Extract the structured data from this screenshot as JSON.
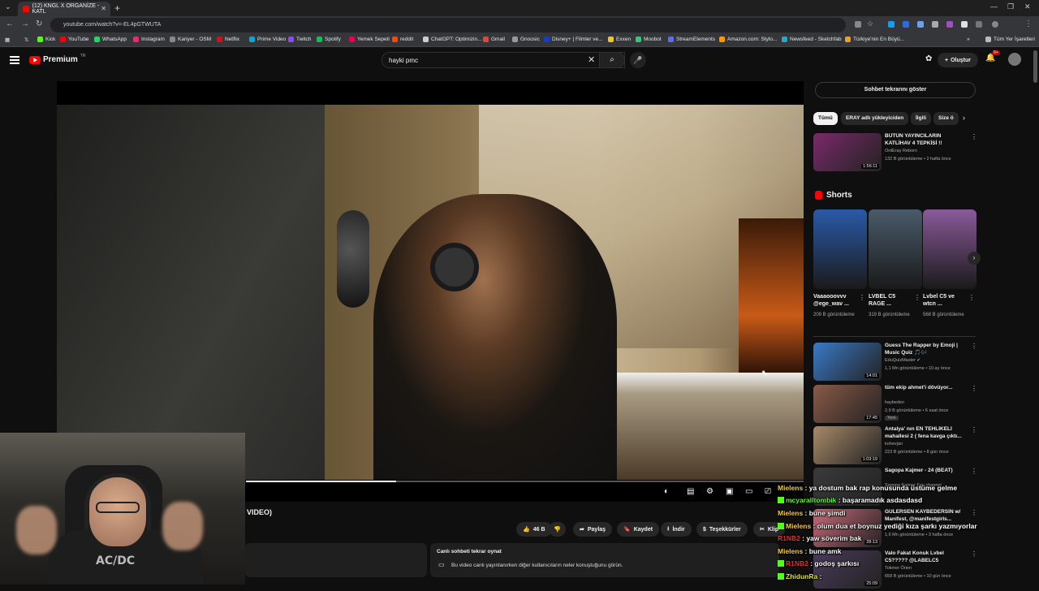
{
  "browser": {
    "tab_title": "(12) KNGL X ORGANİZE - KATL",
    "url": "youtube.com/watch?v=-EL4pGTWUTA",
    "bookmarks": [
      {
        "label": "Kick",
        "color": "#53fc18"
      },
      {
        "label": "YouTube",
        "color": "#ff0000"
      },
      {
        "label": "WhatsApp",
        "color": "#25d366"
      },
      {
        "label": "Instagram",
        "color": "#e1306c"
      },
      {
        "label": "Kariyer - OSM",
        "color": "#888888"
      },
      {
        "label": "Netflix",
        "color": "#e50914"
      },
      {
        "label": "Prime Video",
        "color": "#00a8e1"
      },
      {
        "label": "Twitch",
        "color": "#9146ff"
      },
      {
        "label": "Spotify",
        "color": "#1db954"
      },
      {
        "label": "Yemek Sepeti",
        "color": "#ea004b"
      },
      {
        "label": "reddit",
        "color": "#ff4500"
      },
      {
        "label": "ChatGPT: Optimizin...",
        "color": "#cccccc"
      },
      {
        "label": "Gmail",
        "color": "#ea4335"
      },
      {
        "label": "Gnoosic",
        "color": "#999999"
      },
      {
        "label": "Disney+ | Filmler ve...",
        "color": "#113ccf"
      },
      {
        "label": "Exxen",
        "color": "#f5c518"
      },
      {
        "label": "Moobot",
        "color": "#2ecc71"
      },
      {
        "label": "StreamElements",
        "color": "#5a6cff"
      },
      {
        "label": "Amazon.com: Stylo...",
        "color": "#ff9900"
      },
      {
        "label": "Newsfeed - Sketchfab",
        "color": "#1caad9"
      },
      {
        "label": "Türkiye'nin En Büyü...",
        "color": "#f0a020"
      }
    ],
    "all_bookmarks_label": "Tüm Yer İşaretleri"
  },
  "header": {
    "logo_text": "Premium",
    "logo_country": "TR",
    "search_value": "hayki pmc",
    "create_label": "Oluştur",
    "notif_count": "9+"
  },
  "player": {
    "progress": 0.27,
    "title_visible": "VIDEO)"
  },
  "actions": {
    "like_count": "46 B",
    "share": "Paylaş",
    "save": "Kaydet",
    "download": "İndir",
    "thanks": "Teşekkürler",
    "clip": "Klip"
  },
  "replay": {
    "title": "Canlı sohbeti tekrar oynat",
    "text": "Bu video canlı yayınlanırken diğer kullanıcıların neler konuştuğunu görün."
  },
  "webcam": {
    "shirt_text": "AC/DC"
  },
  "sidebar": {
    "chat_button": "Sohbet tekrarını göster",
    "chips": [
      "Tümü",
      "ERAY adlı yükleyiciden",
      "İlgili",
      "Size ö"
    ],
    "shorts_title": "Shorts",
    "videos": [
      {
        "title": "BÜTÜN YAYINCILARIN KATLİHAV 4 TEPKİSİ !!",
        "channel": "OrdEray Reborn",
        "meta": "132 B görüntüleme • 2 hafta önce",
        "duration": "1:56:11",
        "color": "#7a2a6a"
      },
      {
        "title": "Guess The Rapper by Emoji | Music Quiz 🎵🎶",
        "channel": "EduQuizMaster ✔",
        "meta": "1,1 Mn görüntüleme • 10 ay önce",
        "duration": "14:01",
        "color": "#3a7ac8"
      },
      {
        "title": "tüm ekip ahmet'i dövüyor...",
        "channel": "haybeden",
        "meta": "2,9 B görüntüleme • 6 saat önce",
        "badge": "Yeni",
        "duration": "17:45",
        "color": "#8a5a48"
      },
      {
        "title": "Antalya' nın EN TEHLİKELİ mahallesi 2 ( fena kavga çıktı...",
        "channel": "kohevjan",
        "meta": "223 B görüntüleme • 8 gün önce",
        "duration": "1:03:19",
        "color": "#a88a6a"
      },
      {
        "title": "Sagopa Kajmer - 24 (BEAT)",
        "channel": "Sagopa Kajmer Fan channel",
        "meta": "",
        "duration": "",
        "color": "#3a3a3a"
      },
      {
        "title": "GÜLERSEN KAYBEDERSİN w/ Manifest, @manifestgirls...",
        "channel": "",
        "meta": "1,6 Mn görüntüleme • 3 hafta önce",
        "duration": "28:13",
        "color": "#c86a7a"
      },
      {
        "title": "Valo Fakat Konuk Lvbel C5????? @LABELC5 @overdosevl",
        "channel": "Tokmer Önen",
        "meta": "658 B görüntüleme • 10 gün önce",
        "duration": "25:09",
        "color": "#4a3a5a"
      }
    ],
    "shorts": [
      {
        "title": "Vaaaooovvv @ege_wav ...",
        "views": "209 B görüntüleme",
        "color": "#2a5aa8"
      },
      {
        "title": "LVBEL C5 RAGE ...",
        "views": "319 B görüntüleme",
        "color": "#4a5a6a"
      },
      {
        "title": "Lvbel C5 ve wtcn ...",
        "views": "568 B görüntüleme",
        "color": "#8a5a9a"
      }
    ]
  },
  "chat": [
    {
      "user": "Mielens",
      "text": ": ya dostum bak rap konusunda üstüme gelme",
      "color": "#f5c542",
      "badge": ""
    },
    {
      "user": "mcyaralltombik",
      "text": ": başaramadık asdasdasd",
      "color": "#53fc18",
      "badge": "#53fc18"
    },
    {
      "user": "Mielens",
      "text": ": bune şimdi",
      "color": "#f5c542",
      "badge": ""
    },
    {
      "user": "Mielens",
      "text": ": olum dua et boynuz yediği kıza şarkı yazmıyorlar",
      "color": "#f5c542",
      "badge": "#53fc18"
    },
    {
      "user": "R1NB2",
      "text": ": yaw söverim bak",
      "color": "#e03030",
      "badge": ""
    },
    {
      "user": "Mielens",
      "text": ": bune amk",
      "color": "#f5c542",
      "badge": ""
    },
    {
      "user": "R1NB2",
      "text": ": godoş şarkısı",
      "color": "#e03030",
      "badge": "#53fc18"
    },
    {
      "user": "Mielens",
      "text": ":",
      "color": "#f5c542",
      "badge": ""
    },
    {
      "user": "ZhidunRa",
      "text": ":",
      "color": "#e0e030",
      "badge": "#53fc18"
    }
  ]
}
